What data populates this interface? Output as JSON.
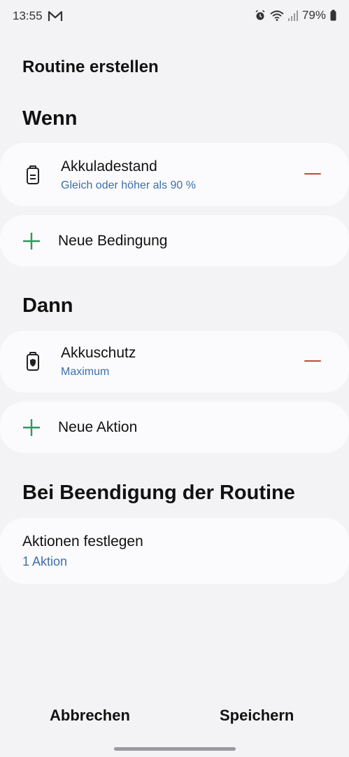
{
  "status_bar": {
    "time": "13:55",
    "battery_percent": "79%",
    "icons": [
      "mail-icon",
      "alarm-icon",
      "wifi-icon",
      "signal-icon",
      "battery-icon"
    ]
  },
  "page": {
    "title": "Routine erstellen"
  },
  "if_section": {
    "title": "Wenn",
    "condition": {
      "icon": "battery-level-icon",
      "title": "Akkuladestand",
      "subtitle": "Gleich oder höher als 90 %"
    },
    "add_label": "Neue Bedingung"
  },
  "then_section": {
    "title": "Dann",
    "action": {
      "icon": "battery-protect-icon",
      "title": "Akkuschutz",
      "subtitle": "Maximum"
    },
    "add_label": "Neue Aktion"
  },
  "end_section": {
    "title": "Bei Beendigung der Routine",
    "item_title": "Aktionen festlegen",
    "item_sub": "1 Aktion"
  },
  "bottom": {
    "cancel": "Abbrechen",
    "save": "Speichern"
  },
  "colors": {
    "background": "#f3f3f6",
    "card": "#fbfbfd",
    "accent_blue": "#3e6fa8",
    "remove_red": "#c9463d",
    "add_green": "#2e9a5a"
  }
}
